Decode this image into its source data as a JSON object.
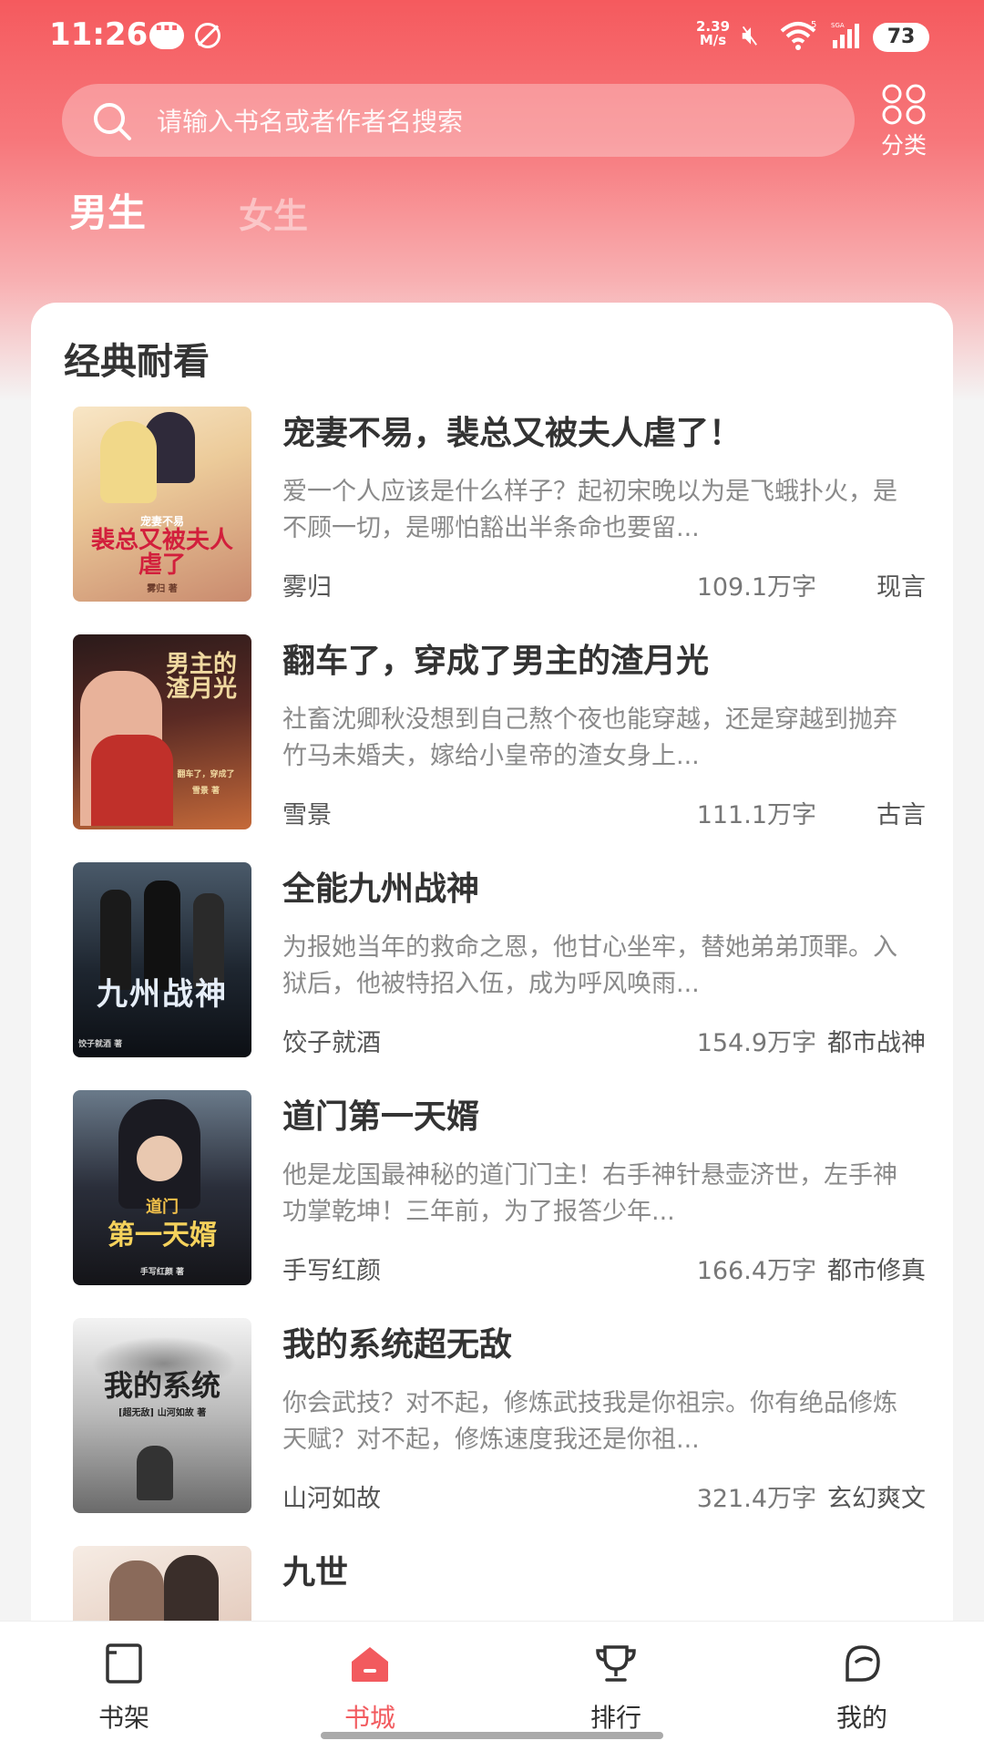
{
  "status_bar": {
    "time": "11:26",
    "net_speed_value": "2.39",
    "net_speed_unit": "M/s",
    "wifi_badge": "5",
    "signal_badge": "SGA",
    "battery": "73"
  },
  "search": {
    "placeholder": "请输入书名或者作者名搜索"
  },
  "category": {
    "label": "分类"
  },
  "gender_tabs": [
    {
      "label": "男生",
      "active": true
    },
    {
      "label": "女生",
      "active": false
    }
  ],
  "section": {
    "title": "经典耐看"
  },
  "books": [
    {
      "title": "宠妻不易，裴总又被夫人虐了！",
      "desc": "爱一个人应该是什么样子？起初宋晚以为是飞蛾扑火，是不顾一切，是哪怕豁出半条命也要留...",
      "author": "雾归",
      "words": "109.1万字",
      "genre": "现言",
      "cover_text": "裴总又被夫人虐了",
      "cover_sub": "宠妻不易",
      "cover_author": "雾归 著"
    },
    {
      "title": "翻车了，穿成了男主的渣月光",
      "desc": "社畜沈卿秋没想到自己熬个夜也能穿越，还是穿越到抛弃竹马未婚夫，嫁给小皇帝的渣女身上...",
      "author": "雪景",
      "words": "111.1万字",
      "genre": "古言",
      "cover_text": "男主的渣月光",
      "cover_sub": "翻车了，穿成了",
      "cover_author": "雪景 著"
    },
    {
      "title": "全能九州战神",
      "desc": "为报她当年的救命之恩，他甘心坐牢，替她弟弟顶罪。入狱后，他被特招入伍，成为呼风唤雨...",
      "author": "饺子就酒",
      "words": "154.9万字",
      "genre": "都市战神",
      "cover_text": "九州战神",
      "cover_sub": "",
      "cover_author": "饺子就酒 著"
    },
    {
      "title": "道门第一天婿",
      "desc": "他是龙国最神秘的道门门主！右手神针悬壶济世，左手神功掌乾坤！三年前，为了报答少年...",
      "author": "手写红颜",
      "words": "166.4万字",
      "genre": "都市修真",
      "cover_text": "第一天婿",
      "cover_sub": "道门",
      "cover_author": "手写红颜 著"
    },
    {
      "title": "我的系统超无敌",
      "desc": "你会武技？对不起，修炼武技我是你祖宗。你有绝品修炼天赋？对不起，修炼速度我还是你祖...",
      "author": "山河如故",
      "words": "321.4万字",
      "genre": "玄幻爽文",
      "cover_text": "我的系统",
      "cover_sub": "[超无敌] 山河如故 著",
      "cover_author": ""
    },
    {
      "title": "九世",
      "desc": "...",
      "author": "",
      "words": "",
      "genre": "",
      "cover_text": "",
      "cover_sub": "",
      "cover_author": ""
    }
  ],
  "bottom_nav": [
    {
      "label": "书架",
      "icon": "bookshelf-icon",
      "active": false
    },
    {
      "label": "书城",
      "icon": "store-icon",
      "active": true
    },
    {
      "label": "排行",
      "icon": "trophy-icon",
      "active": false
    },
    {
      "label": "我的",
      "icon": "profile-icon",
      "active": false
    }
  ],
  "colors": {
    "brand": "#f25a5e",
    "header_top": "#f55a5e",
    "text_primary": "#333333",
    "text_secondary": "#8a8a8a"
  }
}
